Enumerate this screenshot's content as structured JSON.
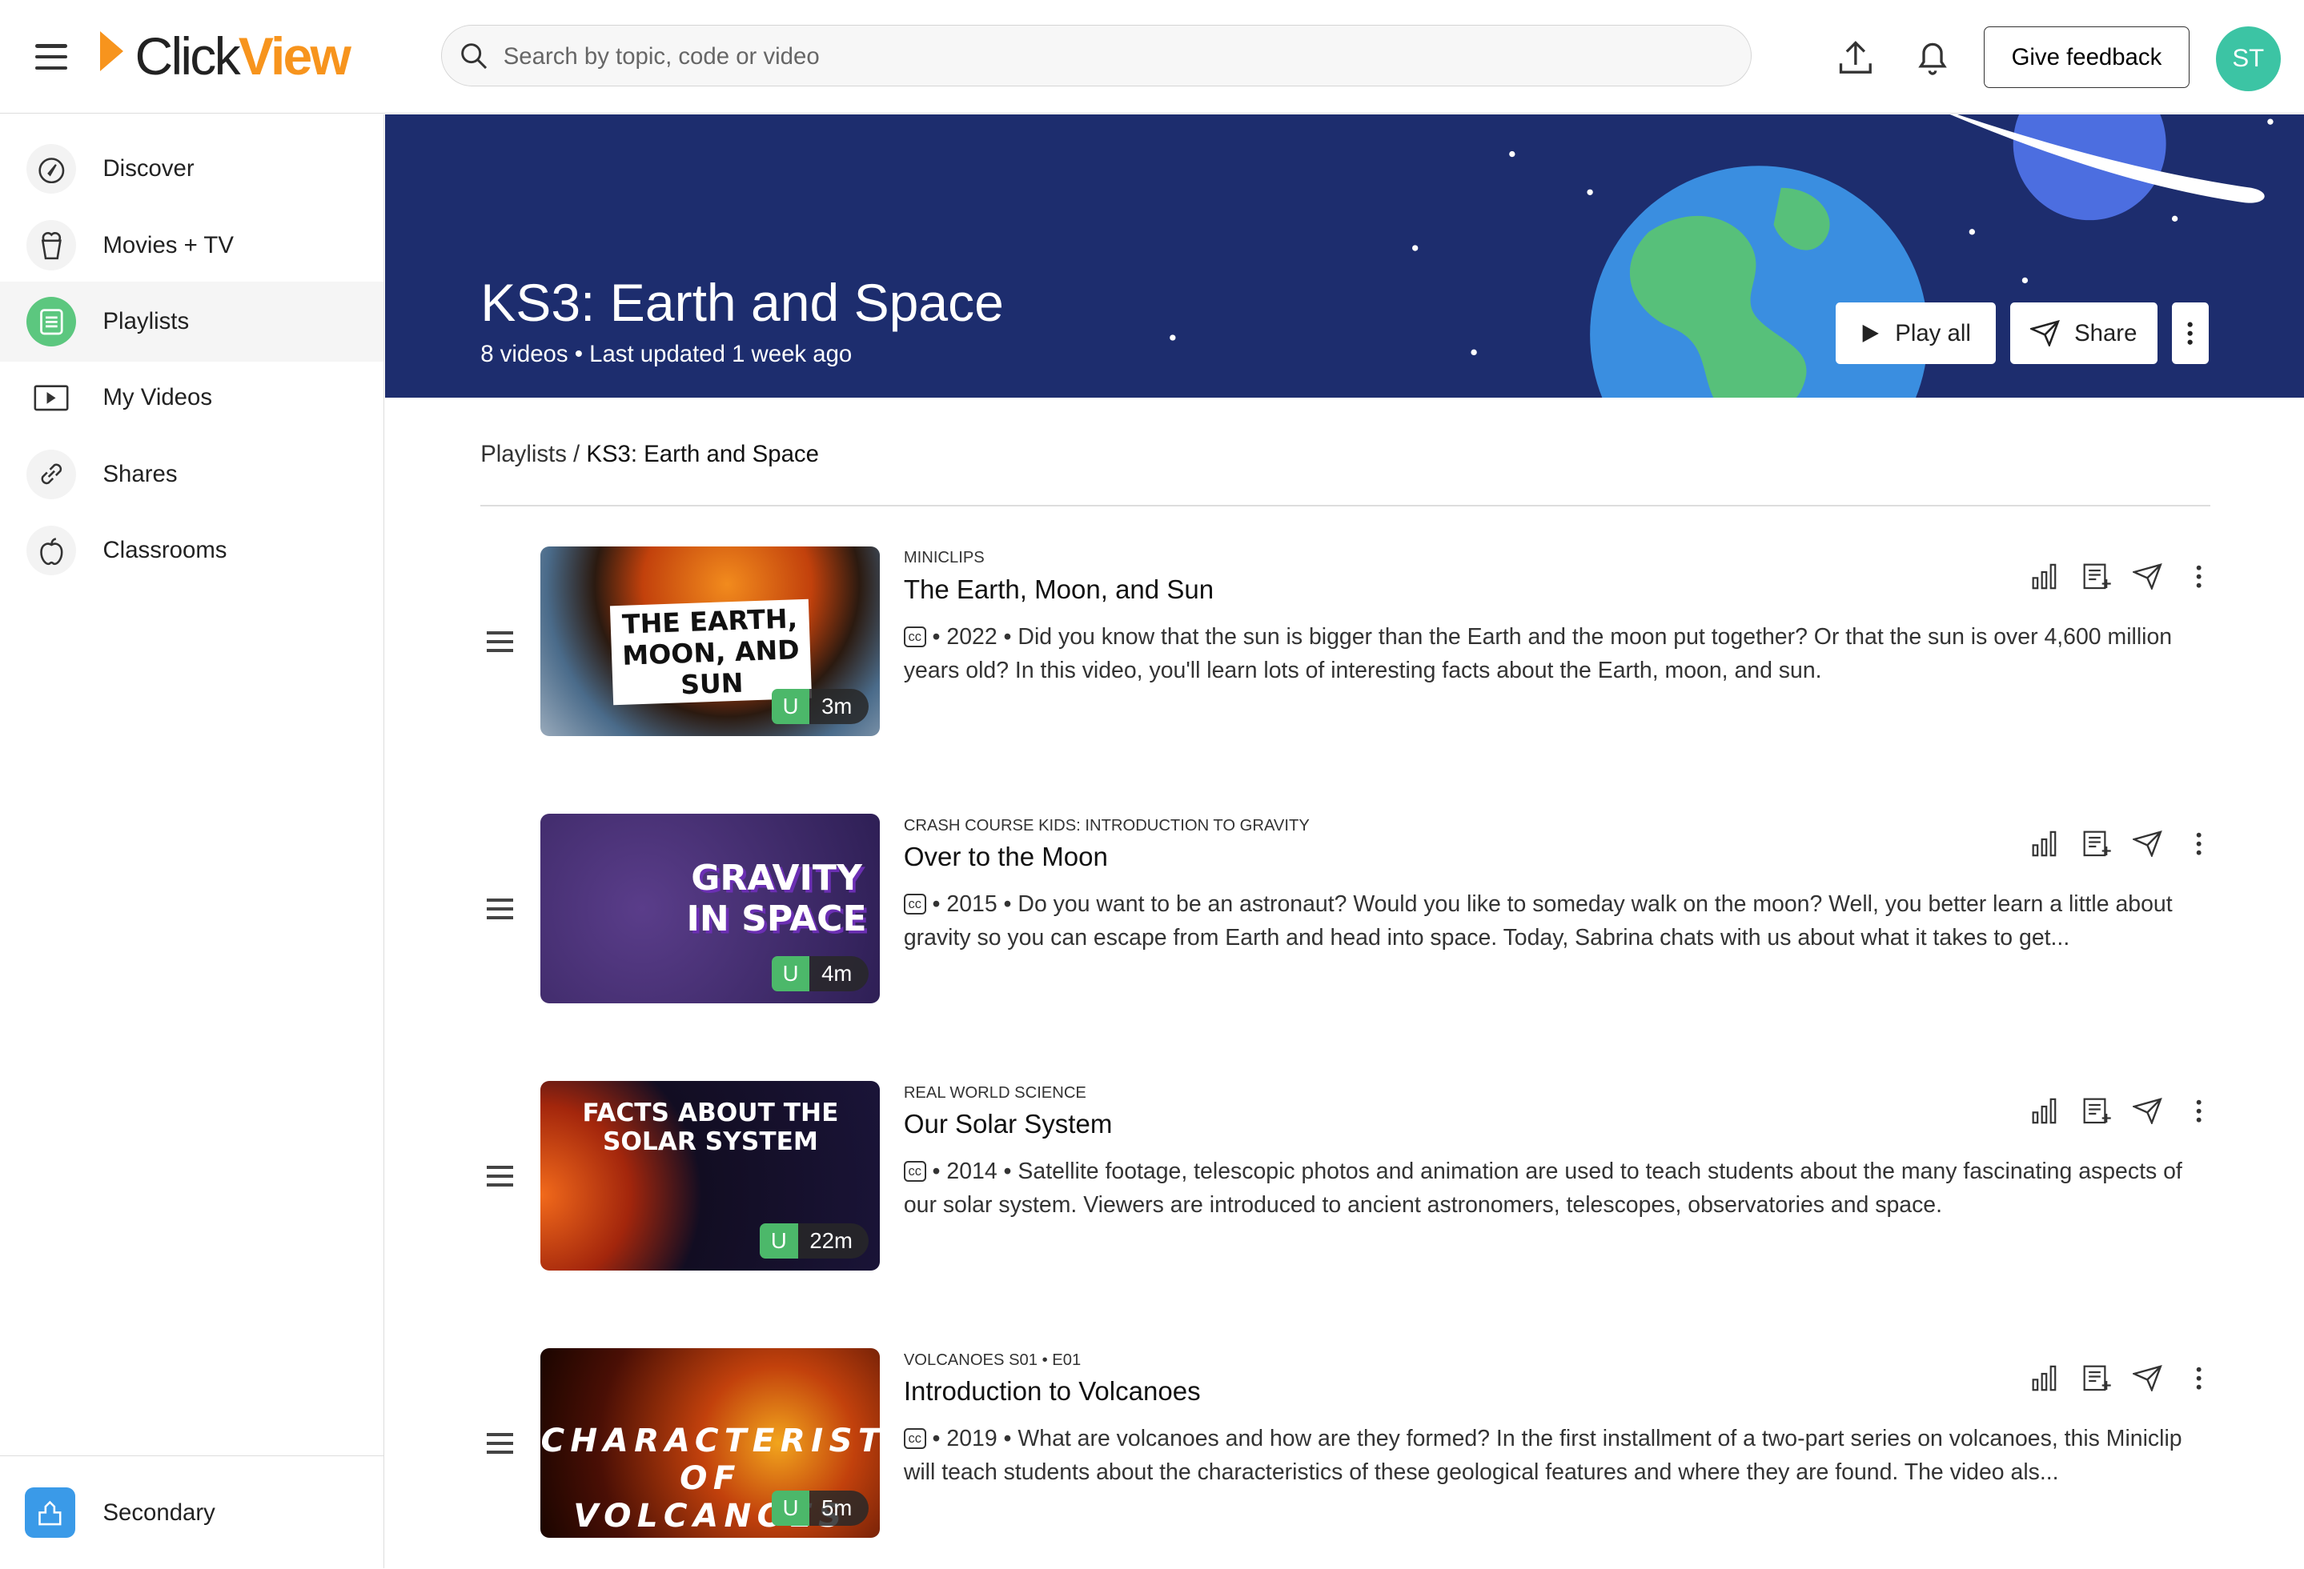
{
  "header": {
    "logo_click": "Click",
    "logo_view": "View",
    "search_placeholder": "Search by topic, code or video",
    "feedback_label": "Give feedback",
    "avatar_initials": "ST"
  },
  "sidebar": {
    "items": [
      {
        "label": "Discover",
        "icon": "compass-icon"
      },
      {
        "label": "Movies + TV",
        "icon": "popcorn-icon"
      },
      {
        "label": "Playlists",
        "icon": "playlist-icon",
        "active": true
      },
      {
        "label": "My Videos",
        "icon": "video-icon"
      },
      {
        "label": "Shares",
        "icon": "link-icon"
      },
      {
        "label": "Classrooms",
        "icon": "apple-icon"
      }
    ],
    "footer_label": "Secondary"
  },
  "hero": {
    "title": "KS3: Earth and Space",
    "meta": "8 videos • Last updated 1 week ago",
    "play_all": "Play all",
    "share": "Share"
  },
  "breadcrumb": {
    "parent": "Playlists",
    "separator": " / ",
    "current": "KS3: Earth and Space"
  },
  "videos": [
    {
      "series": "Miniclips",
      "title": "The Earth, Moon, and Sun",
      "cc": "cc",
      "desc": "• 2022 • Did you know that the sun is bigger than the Earth and the moon put together? Or that the sun is over 4,600 million years old? In this video, you'll learn lots of interesting facts about the Earth, moon, and sun.",
      "rating": "U",
      "duration": "3m",
      "thumb_text": "THE EARTH, MOON, AND SUN"
    },
    {
      "series": "Crash Course Kids: Introduction to Gravity",
      "title": "Over to the Moon",
      "cc": "cc",
      "desc": "• 2015 • Do you want to be an astronaut? Would you like to someday walk on the moon? Well, you better learn a little about gravity so you can escape from Earth and head into space. Today, Sabrina chats with us about what it takes to get...",
      "rating": "U",
      "duration": "4m",
      "thumb_text": "GRAVITY IN SPACE"
    },
    {
      "series": "Real World Science",
      "title": "Our Solar System",
      "cc": "cc",
      "desc": "• 2014 • Satellite footage, telescopic photos and animation are used to teach students about the many fascinating aspects of our solar system. Viewers are introduced to ancient astronomers, telescopes, observatories and space.",
      "rating": "U",
      "duration": "22m",
      "thumb_text": "FACTS ABOUT THE SOLAR SYSTEM"
    },
    {
      "series": "Volcanoes S01 • E01",
      "title": "Introduction to Volcanoes",
      "cc": "cc",
      "desc": "• 2019 • What are volcanoes and how are they formed? In the first installment of a two-part series on volcanoes, this Miniclip will teach students about the characteristics of these geological features and where they are found. The video als...",
      "rating": "U",
      "duration": "5m",
      "thumb_text": "CHARACTERISTICS OF VOLCANOES"
    }
  ],
  "colors": {
    "brand_orange": "#f7941d",
    "hero_bg": "#1d2d6e",
    "active_green": "#5cc77f",
    "avatar": "#3cc4a4"
  }
}
